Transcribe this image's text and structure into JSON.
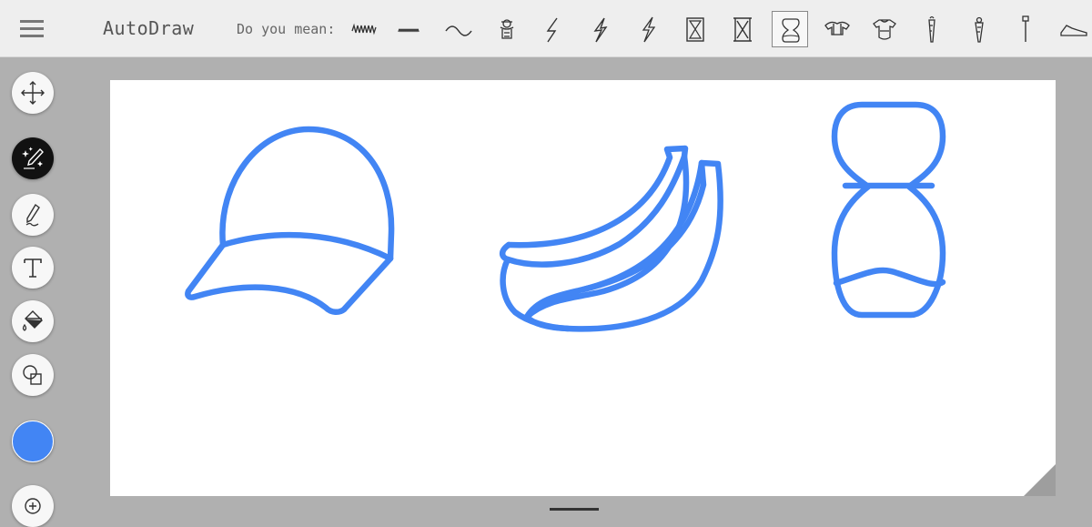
{
  "header": {
    "app_title": "AutoDraw",
    "suggestion_label": "Do you mean:",
    "suggestions": [
      {
        "icon": "zigzag-scribble-icon"
      },
      {
        "icon": "wave-scribble-icon"
      },
      {
        "icon": "tilde-wave-icon"
      },
      {
        "icon": "mascot-head-icon"
      },
      {
        "icon": "lightning-bolt-icon"
      },
      {
        "icon": "lightning-bolt-bold-icon"
      },
      {
        "icon": "lightning-bolt-outline-icon"
      },
      {
        "icon": "framed-hourglass-icon"
      },
      {
        "icon": "framed-hourglass-alt-icon"
      },
      {
        "icon": "hourglass-icon",
        "selected": true
      },
      {
        "icon": "football-pads-icon"
      },
      {
        "icon": "chest-protector-icon"
      },
      {
        "icon": "carrot-icon"
      },
      {
        "icon": "carrot-alt-icon"
      },
      {
        "icon": "pin-icon"
      },
      {
        "icon": "shoe-icon"
      }
    ]
  },
  "toolbar": {
    "tools": [
      {
        "icon": "move-icon"
      },
      {
        "icon": "autodraw-icon",
        "active": true
      },
      {
        "icon": "pencil-icon"
      },
      {
        "icon": "text-icon"
      },
      {
        "icon": "fill-bucket-icon"
      },
      {
        "icon": "shapes-icon"
      }
    ],
    "current_color": "#4285f4",
    "zoom_icon": "zoom-in-icon"
  },
  "canvas": {
    "stroke_color": "#4285f4",
    "drawings": [
      "cap-drawing",
      "bananas-drawing",
      "hourglass-drawing"
    ]
  }
}
